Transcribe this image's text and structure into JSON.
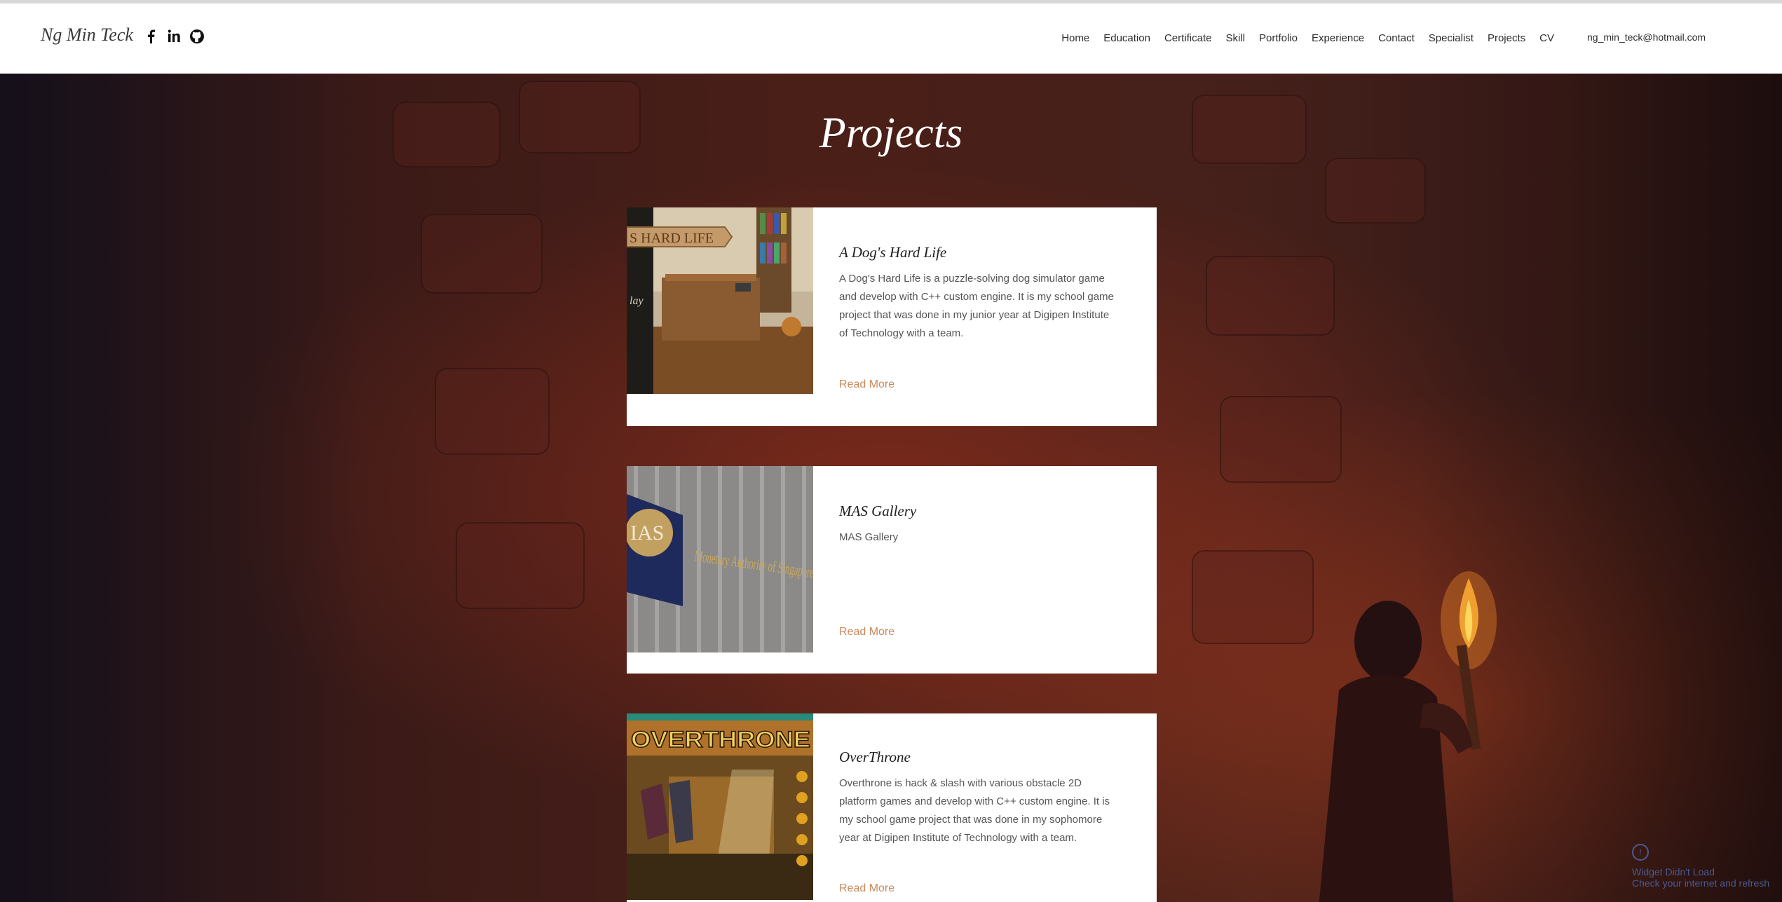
{
  "site": {
    "logo": "Ng Min Teck",
    "email": "ng_min_teck@hotmail.com"
  },
  "social": [
    {
      "name": "facebook-icon"
    },
    {
      "name": "linkedin-icon"
    },
    {
      "name": "github-icon"
    }
  ],
  "nav": [
    "Home",
    "Education",
    "Certificate",
    "Skill",
    "Portfolio",
    "Experience",
    "Contact",
    "Specialist",
    "Projects",
    "CV"
  ],
  "page": {
    "title": "Projects"
  },
  "projects": [
    {
      "title": "A Dog's Hard Life",
      "description": "A Dog's Hard Life is a puzzle-solving dog simulator game and develop with C++ custom engine. It is my school game project that was done in my junior year at Digipen Institute of Technology with a team.",
      "link": "Read More",
      "thumb_text": "S HARD LIFE",
      "thumb_side": "lay"
    },
    {
      "title": "MAS Gallery",
      "description": "MAS Gallery",
      "link": "Read More",
      "thumb_text": "Monetary Authority of Singapore",
      "thumb_badge": "IAS"
    },
    {
      "title": "OverThrone",
      "description": "Overthrone is hack & slash with various obstacle 2D platform games and develop with C++ custom engine. It is my school game project that was done in my sophomore year at Digipen Institute of Technology with a team.",
      "link": "Read More",
      "thumb_text": "OVERTHRONE"
    }
  ],
  "widget": {
    "line1": "Widget Didn't Load",
    "line2": "Check your internet and refresh"
  },
  "colors": {
    "accent": "#c98a5c",
    "header_bg": "#ffffff",
    "title": "#ffffff"
  }
}
